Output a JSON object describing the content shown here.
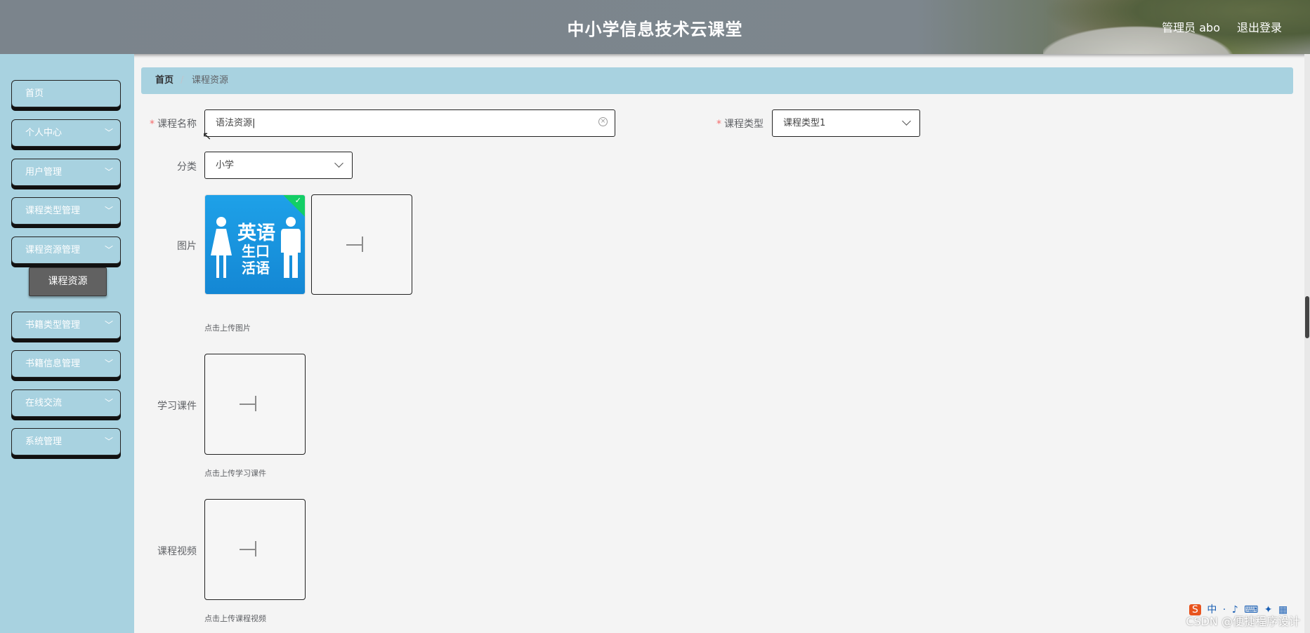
{
  "header": {
    "title": "中小学信息技术云课堂",
    "user": "管理员 abo",
    "logout": "退出登录"
  },
  "sidebar": {
    "items": [
      {
        "label": "首页"
      },
      {
        "label": "个人中心"
      },
      {
        "label": "用户管理"
      },
      {
        "label": "课程类型管理"
      },
      {
        "label": "课程资源管理"
      },
      {
        "label": "书籍类型管理"
      },
      {
        "label": "书籍信息管理"
      },
      {
        "label": "在线交流"
      },
      {
        "label": "系统管理"
      }
    ],
    "active_sub": "课程资源"
  },
  "breadcrumb": {
    "home": "首页",
    "separator": "/",
    "current": "课程资源"
  },
  "form": {
    "course_name": {
      "label": "课程名称",
      "value": "语法资源"
    },
    "course_type": {
      "label": "课程类型",
      "value": "课程类型1"
    },
    "category": {
      "label": "分类",
      "value": "小学"
    },
    "image": {
      "label": "图片",
      "hint": "点击上传图片",
      "thumb_word1": "英语",
      "thumb_word2": "生口活语"
    },
    "courseware": {
      "label": "学习课件",
      "hint": "点击上传学习课件"
    },
    "video": {
      "label": "课程视频",
      "hint": "点击上传课程视频"
    }
  },
  "watermark": "CSDN @便捷程序设计",
  "tray": [
    "S",
    "中",
    "·",
    "♪",
    "⌨",
    "✦",
    "▦"
  ]
}
